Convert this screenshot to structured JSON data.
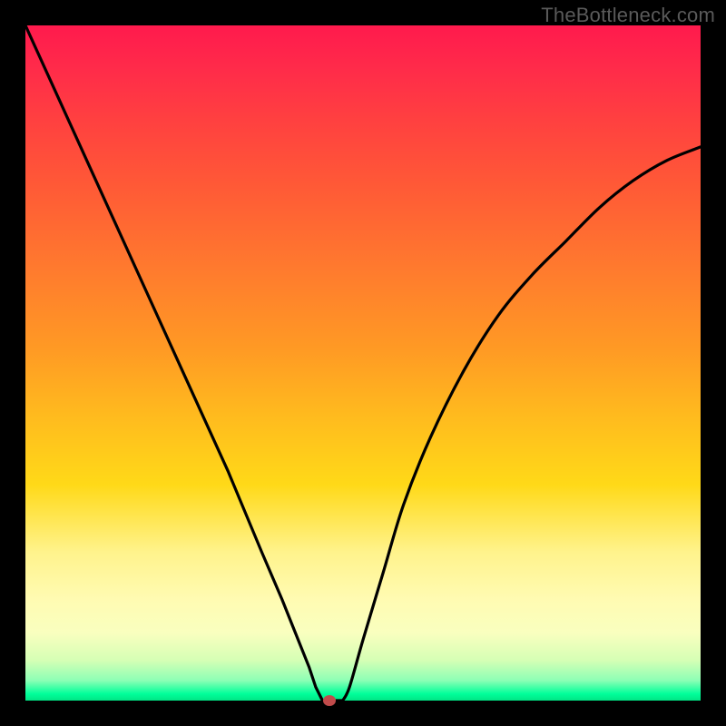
{
  "watermark": "TheBottleneck.com",
  "colors": {
    "frame": "#000000",
    "curve": "#000000",
    "marker": "#c14b4b"
  },
  "chart_data": {
    "type": "line",
    "title": "",
    "xlabel": "",
    "ylabel": "",
    "xlim": [
      0,
      100
    ],
    "ylim": [
      0,
      100
    ],
    "grid": false,
    "legend": false,
    "series": [
      {
        "name": "curve",
        "x": [
          0,
          5,
          10,
          15,
          20,
          25,
          30,
          35,
          38,
          40,
          42,
          43,
          44,
          45,
          46,
          47,
          48,
          50,
          53,
          56,
          60,
          65,
          70,
          75,
          80,
          85,
          90,
          95,
          100
        ],
        "y": [
          100,
          89,
          78,
          67,
          56,
          45,
          34,
          22,
          15,
          10,
          5,
          2,
          0,
          0,
          0,
          0,
          2,
          9,
          19,
          29,
          39,
          49,
          57,
          63,
          68,
          73,
          77,
          80,
          82
        ]
      }
    ],
    "marker": {
      "x": 45,
      "y": 0
    },
    "annotations": []
  }
}
